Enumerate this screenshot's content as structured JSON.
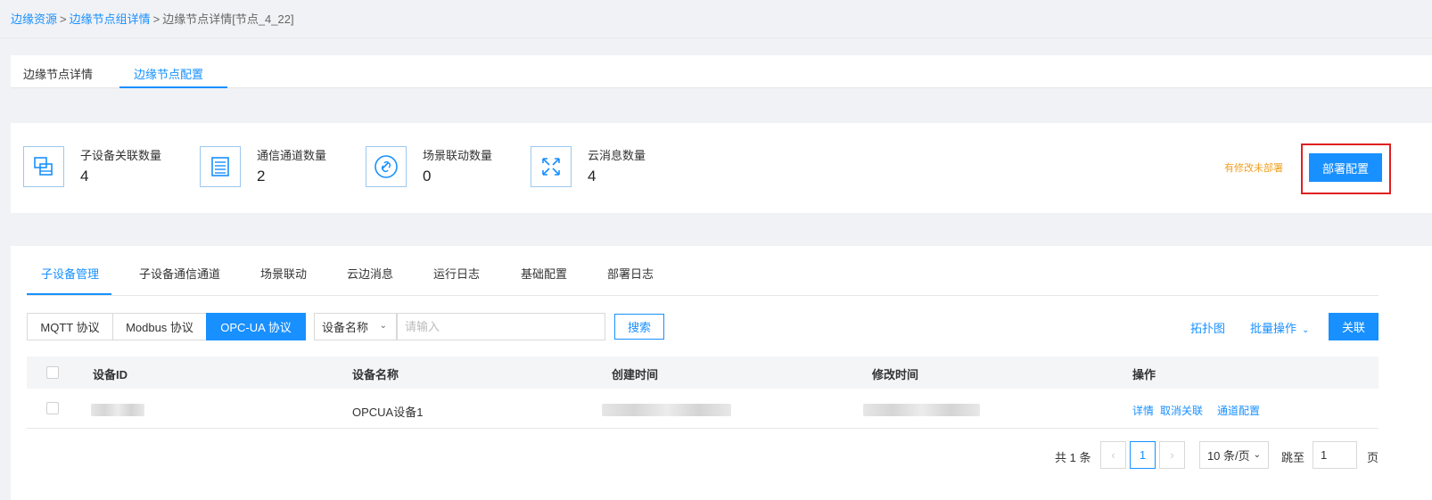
{
  "breadcrumb": {
    "items": [
      "边缘资源",
      "边缘节点组详情",
      "边缘节点详情[节点_4_22]"
    ],
    "separator": ">"
  },
  "top_tabs": [
    {
      "label": "边缘节点详情",
      "active": false
    },
    {
      "label": "边缘节点配置",
      "active": true
    }
  ],
  "stats": [
    {
      "label": "子设备关联数量",
      "value": "4",
      "icon": "devices-icon"
    },
    {
      "label": "通信通道数量",
      "value": "2",
      "icon": "channel-list-icon"
    },
    {
      "label": "场景联动数量",
      "value": "0",
      "icon": "link-icon"
    },
    {
      "label": "云消息数量",
      "value": "4",
      "icon": "arrows-icon"
    }
  ],
  "deploy": {
    "warning": "有修改未部署",
    "button_label": "部署配置"
  },
  "sub_tabs": [
    {
      "label": "子设备管理",
      "active": true
    },
    {
      "label": "子设备通信通道",
      "active": false
    },
    {
      "label": "场景联动",
      "active": false
    },
    {
      "label": "云边消息",
      "active": false
    },
    {
      "label": "运行日志",
      "active": false
    },
    {
      "label": "基础配置",
      "active": false
    },
    {
      "label": "部署日志",
      "active": false
    }
  ],
  "protocols": [
    {
      "label": "MQTT 协议",
      "active": false
    },
    {
      "label": "Modbus 协议",
      "active": false
    },
    {
      "label": "OPC-UA 协议",
      "active": true
    }
  ],
  "search": {
    "field_select": "设备名称",
    "placeholder": "请输入",
    "value": "",
    "button_label": "搜索"
  },
  "actions": {
    "topology": "拓扑图",
    "batch": "批量操作",
    "associate": "关联"
  },
  "table": {
    "columns": [
      "设备ID",
      "设备名称",
      "创建时间",
      "修改时间",
      "操作"
    ],
    "rows": [
      {
        "device_id": "",
        "device_name": "OPCUA设备1",
        "created": "",
        "modified": "",
        "ops": [
          "详情",
          "取消关联",
          "通道配置"
        ]
      }
    ]
  },
  "pagination": {
    "total_text": "共 1 条",
    "current_page": "1",
    "page_size": "10 条/页",
    "jump_label": "跳至",
    "jump_value": "1",
    "page_suffix": "页"
  },
  "colors": {
    "primary": "#1890ff",
    "warning": "#f0a020",
    "highlight_border": "#e02020"
  }
}
